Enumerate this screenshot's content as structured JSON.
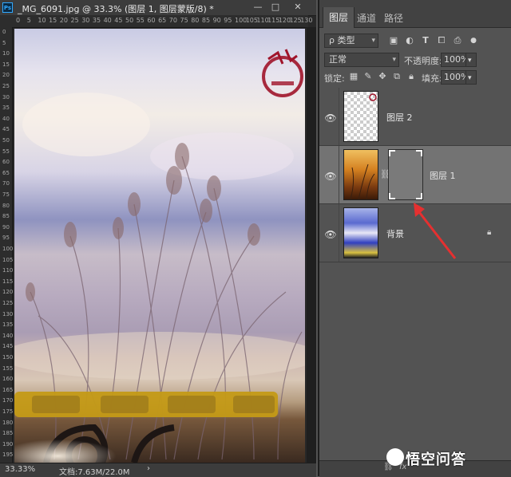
{
  "document": {
    "app_icon": "Ps",
    "title": "_MG_6091.jpg @ 33.3% (图层 1, 图层蒙版/8) *",
    "minimize_icon": "—",
    "restore_icon": "□",
    "close_icon": "✕",
    "ruler_top_ticks": [
      "0",
      "5",
      "10",
      "15",
      "20",
      "25",
      "30",
      "35",
      "40",
      "45",
      "50",
      "55",
      "60",
      "65",
      "70",
      "75",
      "80",
      "85",
      "90",
      "95",
      "100",
      "105",
      "110",
      "115",
      "120",
      "125",
      "130"
    ],
    "ruler_left_ticks": [
      "0",
      "5",
      "10",
      "15",
      "20",
      "25",
      "30",
      "35",
      "40",
      "45",
      "50",
      "55",
      "60",
      "65",
      "70",
      "75",
      "80",
      "85",
      "90",
      "95",
      "100",
      "105",
      "110",
      "115",
      "120",
      "125",
      "130",
      "135",
      "140",
      "145",
      "150",
      "155",
      "160",
      "165",
      "170",
      "175",
      "180",
      "185",
      "190",
      "195"
    ],
    "status": {
      "zoom": "33.33%",
      "doc_info": "文档:7.63M/22.0M",
      "arrow": "›"
    }
  },
  "panel": {
    "tabs": [
      {
        "label": "图层",
        "active": true
      },
      {
        "label": "通道",
        "active": false
      },
      {
        "label": "路径",
        "active": false
      }
    ],
    "filter_type": "ρ 类型",
    "blend_mode": "正常",
    "opacity_label": "不透明度:",
    "opacity_value": "100%",
    "lock_label": "锁定:",
    "fill_label": "填充:",
    "fill_value": "100%",
    "filter_icons": [
      "image-icon",
      "adjustment-icon",
      "type-icon",
      "shape-icon",
      "smart-object-icon",
      "toggle-dot-icon"
    ],
    "lock_icons": [
      "lock-transparent-icon",
      "lock-paint-icon",
      "lock-move-icon",
      "lock-artboard-icon",
      "lock-all-icon"
    ],
    "layers": [
      {
        "name": "图层 2",
        "visible": true,
        "selected": false,
        "has_mask": false,
        "locked": false
      },
      {
        "name": "图层 1",
        "visible": true,
        "selected": true,
        "has_mask": true,
        "locked": false
      },
      {
        "name": "背景",
        "visible": true,
        "selected": false,
        "has_mask": false,
        "locked": true
      }
    ],
    "footer_icons": [
      "link-icon",
      "fx-icon"
    ],
    "footer_fx": "fx"
  },
  "colors": {
    "seal": "#a0142a",
    "arrow": "#e53030",
    "panel_bg": "#535353",
    "selected_row": "#737373"
  },
  "watermark": "悟空问答"
}
